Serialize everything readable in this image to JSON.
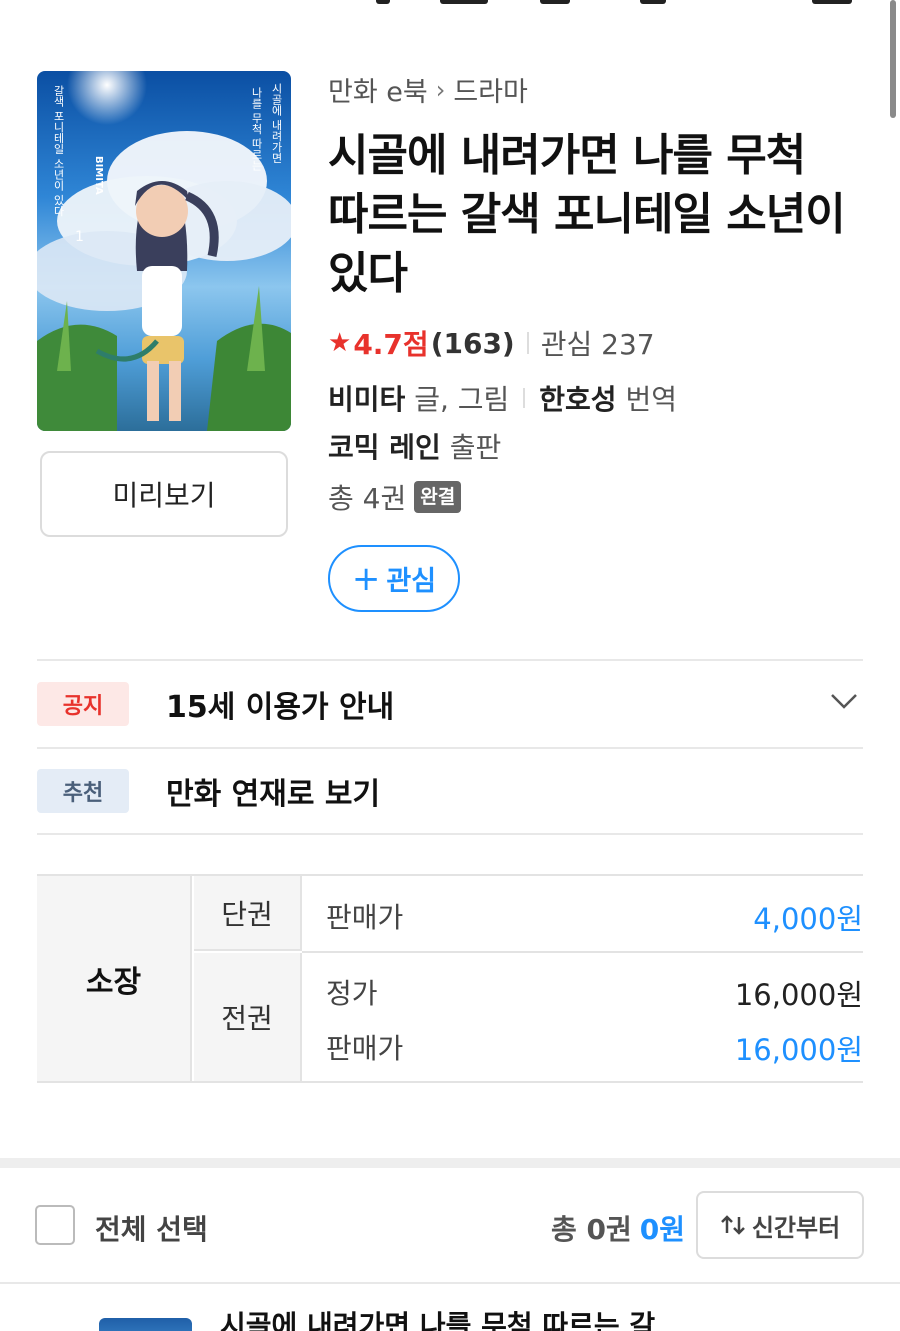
{
  "book": {
    "breadcrumb": {
      "category": "만화 e북",
      "separator": "›",
      "genre": "드라마"
    },
    "title": "시골에 내려가면 나를 무척 따르는 갈색 포니테일 소년이 있다",
    "cover_text": {
      "title_vertical_1": "시골에 내려가면",
      "title_vertical_2": "나를 무척 따르는",
      "title_vertical_3": "갈색 포니테일 소년이 있다",
      "volume": "1",
      "author_mark": "BIMITA"
    },
    "preview_label": "미리보기",
    "rating": {
      "star_icon": "star-icon",
      "score": "4.7점",
      "count": "(163)"
    },
    "interest": "관심 237",
    "author": {
      "name": "비미타",
      "role": "글, 그림"
    },
    "translator": {
      "name": "한호성",
      "role": "번역"
    },
    "publisher": {
      "name": "코믹 레인",
      "role": "출판"
    },
    "total": "총 4권",
    "completed_badge": "완결",
    "follow_label": "관심",
    "follow_icon": "plus-icon"
  },
  "notices": [
    {
      "tag": "공지",
      "text": "15세 이용가 안내",
      "icon": "chevron-down-icon"
    },
    {
      "tag": "추천",
      "text": "만화 연재로 보기"
    }
  ],
  "prices": {
    "type_label": "소장",
    "single": {
      "label": "단권",
      "sale_name": "판매가",
      "sale_price": "4,000원"
    },
    "set": {
      "label": "전권",
      "list_name": "정가",
      "list_price": "16,000원",
      "sale_name": "판매가",
      "sale_price": "16,000원"
    }
  },
  "selection": {
    "select_all_label": "전체 선택",
    "summary_prefix": "총 0권",
    "summary_price": "0원",
    "sort_label": "신간부터",
    "sort_icon": "sort-arrows-icon"
  },
  "list_preview": {
    "title": "시골에 내려가면 나를 무척 따르는 갈"
  },
  "colors": {
    "accent_blue": "#1e90ff",
    "rating_red": "#e8322c",
    "badge_gray": "#666666"
  }
}
